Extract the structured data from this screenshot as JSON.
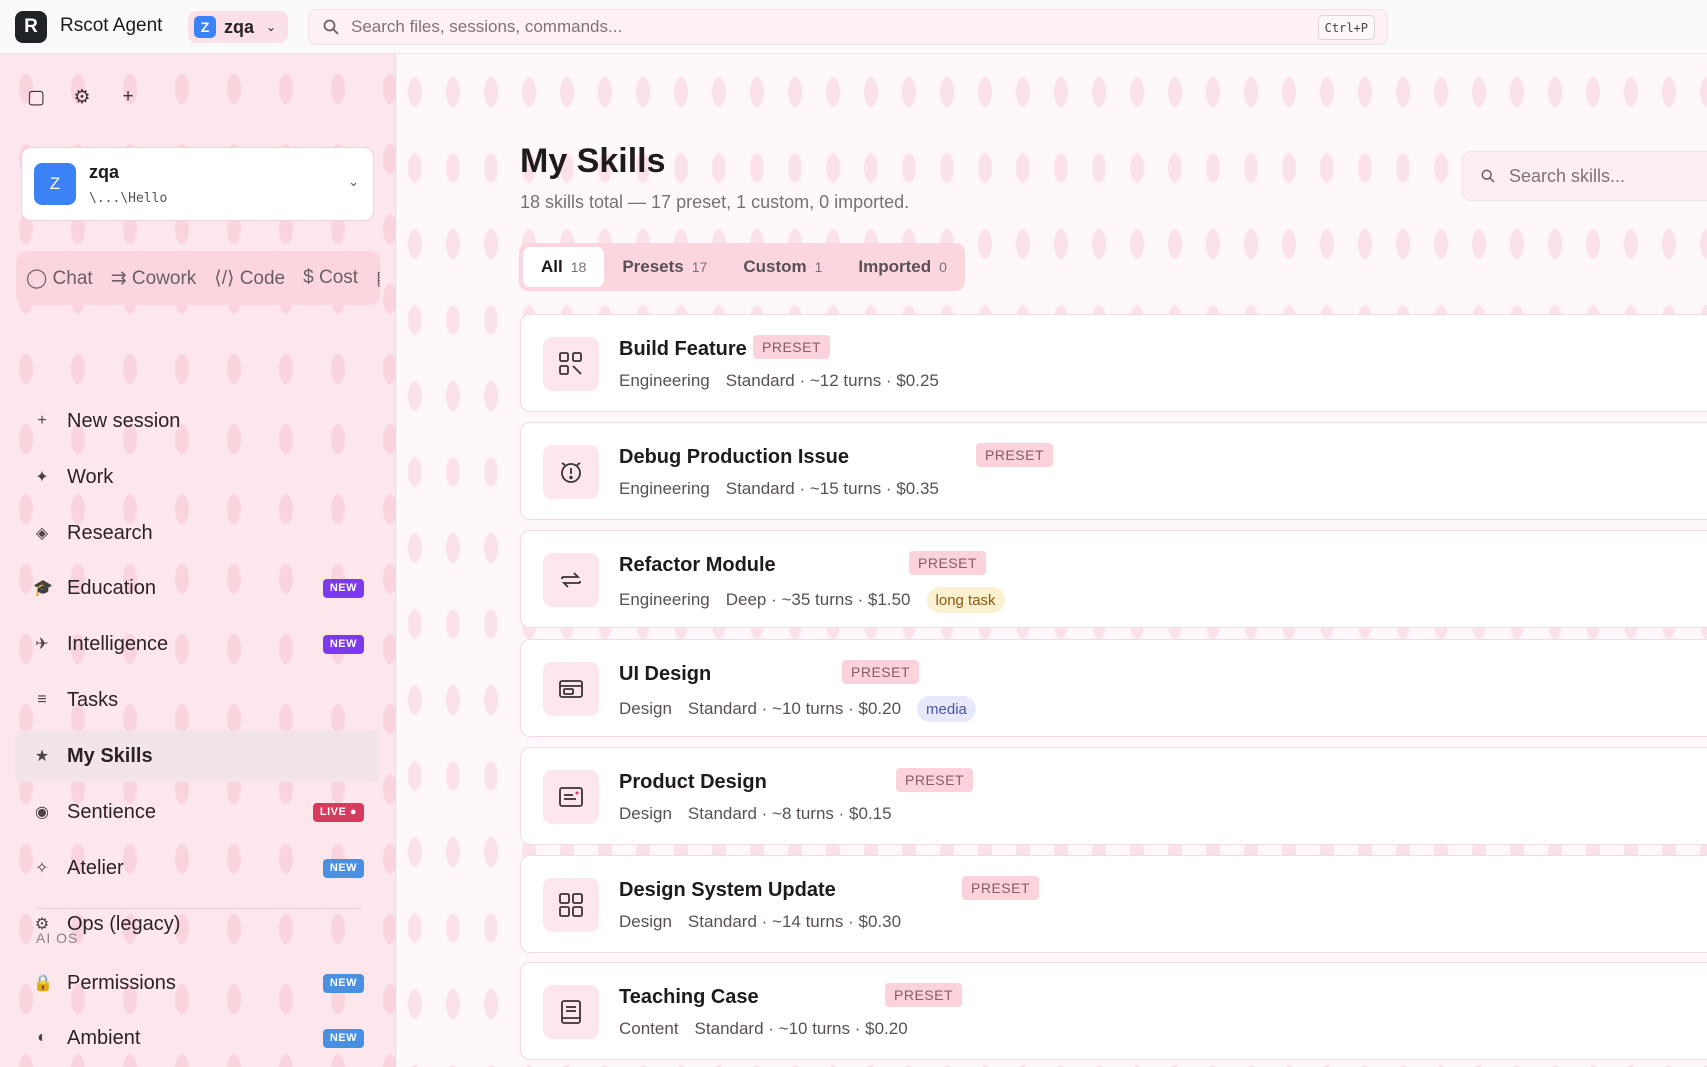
{
  "header": {
    "logo_letter": "R",
    "app_title": "Rscot Agent",
    "workspace_letter": "Z",
    "workspace_name": "zqa",
    "search_placeholder": "Search files, sessions, commands...",
    "shortcut": "Ctrl+P"
  },
  "sidebar": {
    "tools": [
      "▢",
      "⚙",
      "+"
    ],
    "workspace": {
      "letter": "Z",
      "name": "zqa",
      "path": "\\...\\Hello"
    },
    "modes": [
      {
        "icon": "◯",
        "label": "Chat"
      },
      {
        "icon": "⇉",
        "label": "Cowork"
      },
      {
        "icon": "⟨/⟩",
        "label": "Code"
      },
      {
        "icon": "$",
        "label": "Cost"
      },
      {
        "icon": "▦",
        "label": ""
      }
    ],
    "items": [
      {
        "icon": "+",
        "label": "New session",
        "badge": ""
      },
      {
        "icon": "✦",
        "label": "Work",
        "badge": ""
      },
      {
        "icon": "◈",
        "label": "Research",
        "badge": ""
      },
      {
        "icon": "🎓",
        "label": "Education",
        "badge": "NEW"
      },
      {
        "icon": "✈",
        "label": "Intelligence",
        "badge": "NEW"
      },
      {
        "icon": "≡",
        "label": "Tasks",
        "badge": ""
      },
      {
        "icon": "★",
        "label": "My Skills",
        "badge": ""
      },
      {
        "icon": "◉",
        "label": "Sentience",
        "badge": "LIVE ●"
      },
      {
        "icon": "✧",
        "label": "Atelier",
        "badge": "NEW"
      },
      {
        "icon": "⚙",
        "label": "Ops (legacy)",
        "badge": ""
      }
    ],
    "section_label": "AI OS",
    "os_items": [
      {
        "icon": "🔒",
        "label": "Permissions",
        "badge": "NEW"
      },
      {
        "icon": "◐",
        "label": "Ambient",
        "badge": "NEW"
      }
    ]
  },
  "main": {
    "title": "My Skills",
    "subtitle": "18 skills total — 17 preset, 1 custom, 0 imported.",
    "search_placeholder": "Search skills...",
    "tabs": [
      {
        "label": "All",
        "count": "18"
      },
      {
        "label": "Presets",
        "count": "17"
      },
      {
        "label": "Custom",
        "count": "1"
      },
      {
        "label": "Imported",
        "count": "0"
      }
    ],
    "skills": [
      {
        "icon": "apps-icon",
        "title": "Build Feature",
        "tag": "PRESET",
        "category": "Engineering",
        "details": "Standard · ~12 turns · $0.25",
        "pill": ""
      },
      {
        "icon": "alarm-icon",
        "title": "Debug Production Issue",
        "tag": "PRESET",
        "category": "Engineering",
        "details": "Standard · ~15 turns · $0.35",
        "pill": ""
      },
      {
        "icon": "repeat-icon",
        "title": "Refactor Module",
        "tag": "PRESET",
        "category": "Engineering",
        "details": "Deep · ~35 turns · $1.50",
        "pill": "long task"
      },
      {
        "icon": "browser-window-icon",
        "title": "UI Design",
        "tag": "PRESET",
        "category": "Design",
        "details": "Standard · ~10 turns · $0.20",
        "pill": "media"
      },
      {
        "icon": "document-icon",
        "title": "Product Design",
        "tag": "PRESET",
        "category": "Design",
        "details": "Standard · ~8 turns · $0.15",
        "pill": ""
      },
      {
        "icon": "grid-icon",
        "title": "Design System Update",
        "tag": "PRESET",
        "category": "Design",
        "details": "Standard · ~14 turns · $0.30",
        "pill": ""
      },
      {
        "icon": "book-icon",
        "title": "Teaching Case",
        "tag": "PRESET",
        "category": "Content",
        "details": "Standard · ~10 turns · $0.20",
        "pill": ""
      }
    ]
  },
  "colors": {
    "sidebar_bg": "#fde6ec",
    "accent_pink": "#fcd3dd",
    "badge_new_purple": "#7c3aed",
    "badge_new_blue": "#4a90e2",
    "badge_live": "#d63a5c",
    "workspace_blue": "#3b82f6"
  }
}
